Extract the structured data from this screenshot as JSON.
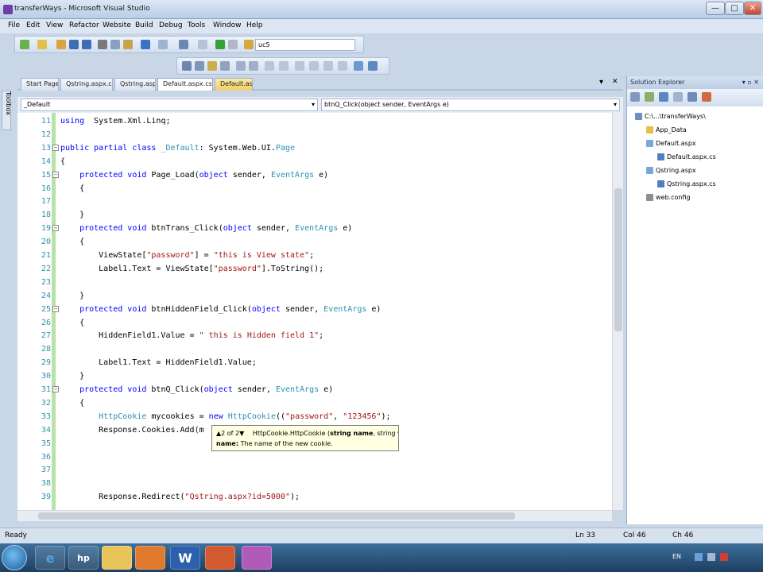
{
  "window": {
    "title": "transferWays - Microsoft Visual Studio",
    "min": "—",
    "max": "□",
    "close": "✕"
  },
  "menu": [
    "File",
    "Edit",
    "View",
    "Refactor",
    "Website",
    "Build",
    "Debug",
    "Tools",
    "Window",
    "Help"
  ],
  "toolbar": {
    "find_combo": "uc5"
  },
  "tabs": [
    "Start Page",
    "Qstring.aspx.cs*",
    "Qstring.aspx",
    "Default.aspx.cs*",
    "Default.aspx"
  ],
  "tab_close": "✕",
  "tab_dropdown": "▾",
  "nav": {
    "class_combo": "_Default",
    "member_combo": "btnQ_Click(object sender, EventArgs e)",
    "arrow": "▾"
  },
  "toolbox_label": "Toolbox",
  "code_lines": [
    {
      "n": "11",
      "fold": "",
      "parts": [
        [
          "kw",
          "using"
        ],
        [
          "",
          "  System.Xml.Linq;"
        ]
      ]
    },
    {
      "n": "12",
      "fold": "",
      "parts": [
        [
          "",
          ""
        ]
      ]
    },
    {
      "n": "13",
      "fold": "−",
      "parts": [
        [
          "kw",
          "public partial class "
        ],
        [
          "ty",
          "_Default"
        ],
        [
          "",
          ": System.Web.UI."
        ],
        [
          "ty",
          "Page"
        ]
      ]
    },
    {
      "n": "14",
      "fold": "",
      "parts": [
        [
          "",
          "{"
        ]
      ]
    },
    {
      "n": "15",
      "fold": "−",
      "parts": [
        [
          "",
          "    "
        ],
        [
          "kw",
          "protected void "
        ],
        [
          "",
          "Page_Load("
        ],
        [
          "kw",
          "object "
        ],
        [
          "",
          "sender, "
        ],
        [
          "ty",
          "EventArgs"
        ],
        [
          "",
          " e)"
        ]
      ]
    },
    {
      "n": "16",
      "fold": "",
      "parts": [
        [
          "",
          "    {"
        ]
      ]
    },
    {
      "n": "17",
      "fold": "",
      "parts": [
        [
          "",
          ""
        ]
      ]
    },
    {
      "n": "18",
      "fold": "",
      "parts": [
        [
          "",
          "    }"
        ]
      ]
    },
    {
      "n": "19",
      "fold": "−",
      "parts": [
        [
          "",
          "    "
        ],
        [
          "kw",
          "protected void "
        ],
        [
          "",
          "btnTrans_Click("
        ],
        [
          "kw",
          "object "
        ],
        [
          "",
          "sender, "
        ],
        [
          "ty",
          "EventArgs"
        ],
        [
          "",
          " e)"
        ]
      ]
    },
    {
      "n": "20",
      "fold": "",
      "parts": [
        [
          "",
          "    {"
        ]
      ]
    },
    {
      "n": "21",
      "fold": "",
      "parts": [
        [
          "",
          "        ViewState["
        ],
        [
          "st",
          "\"password\""
        ],
        [
          "",
          "] = "
        ],
        [
          "st",
          "\"this is View state\""
        ],
        [
          "",
          ";"
        ]
      ]
    },
    {
      "n": "22",
      "fold": "",
      "parts": [
        [
          "",
          "        Label1.Text = ViewState["
        ],
        [
          "st",
          "\"password\""
        ],
        [
          "",
          "].ToString();"
        ]
      ]
    },
    {
      "n": "23",
      "fold": "",
      "parts": [
        [
          "",
          ""
        ]
      ]
    },
    {
      "n": "24",
      "fold": "",
      "parts": [
        [
          "",
          "    }"
        ]
      ]
    },
    {
      "n": "25",
      "fold": "−",
      "parts": [
        [
          "",
          "    "
        ],
        [
          "kw",
          "protected void "
        ],
        [
          "",
          "btnHiddenField_Click("
        ],
        [
          "kw",
          "object "
        ],
        [
          "",
          "sender, "
        ],
        [
          "ty",
          "EventArgs"
        ],
        [
          "",
          " e)"
        ]
      ]
    },
    {
      "n": "26",
      "fold": "",
      "parts": [
        [
          "",
          "    {"
        ]
      ]
    },
    {
      "n": "27",
      "fold": "",
      "parts": [
        [
          "",
          "        HiddenField1.Value = "
        ],
        [
          "st",
          "\" this is Hidden field 1\""
        ],
        [
          "",
          ";"
        ]
      ]
    },
    {
      "n": "28",
      "fold": "",
      "parts": [
        [
          "",
          ""
        ]
      ]
    },
    {
      "n": "29",
      "fold": "",
      "parts": [
        [
          "",
          "        Label1.Text = HiddenField1.Value;"
        ]
      ]
    },
    {
      "n": "30",
      "fold": "",
      "parts": [
        [
          "",
          "    }"
        ]
      ]
    },
    {
      "n": "31",
      "fold": "−",
      "parts": [
        [
          "",
          "    "
        ],
        [
          "kw",
          "protected void "
        ],
        [
          "",
          "btnQ_Click("
        ],
        [
          "kw",
          "object "
        ],
        [
          "",
          "sender, "
        ],
        [
          "ty",
          "EventArgs"
        ],
        [
          "",
          " e)"
        ]
      ]
    },
    {
      "n": "32",
      "fold": "",
      "parts": [
        [
          "",
          "    {"
        ]
      ]
    },
    {
      "n": "33",
      "fold": "",
      "parts": [
        [
          "",
          "        "
        ],
        [
          "ty",
          "HttpCookie"
        ],
        [
          "",
          " mycookies = "
        ],
        [
          "kw",
          "new "
        ],
        [
          "ty",
          "HttpCookie"
        ],
        [
          "",
          "(("
        ],
        [
          "st",
          "\"password\""
        ],
        [
          "",
          ", "
        ],
        [
          "st",
          "\"123456\""
        ],
        [
          "",
          ");"
        ]
      ]
    },
    {
      "n": "34",
      "fold": "",
      "parts": [
        [
          "",
          "        Response.Cookies.Add(m"
        ]
      ]
    },
    {
      "n": "35",
      "fold": "",
      "parts": [
        [
          "",
          ""
        ]
      ]
    },
    {
      "n": "36",
      "fold": "",
      "parts": [
        [
          "",
          ""
        ]
      ]
    },
    {
      "n": "37",
      "fold": "",
      "parts": [
        [
          "",
          ""
        ]
      ]
    },
    {
      "n": "38",
      "fold": "",
      "parts": [
        [
          "",
          ""
        ]
      ]
    },
    {
      "n": "39",
      "fold": "",
      "parts": [
        [
          "",
          "        Response.Redirect("
        ],
        [
          "st",
          "\"Qstring.aspx?id=5000\""
        ],
        [
          "",
          ");"
        ]
      ]
    }
  ],
  "tooltip": {
    "counter": "▲2 of 2▼",
    "signature_pre": "HttpCookie.HttpCookie (",
    "param_bold": "string name",
    "signature_post": ", string value)",
    "param_label": "name:",
    "param_desc": "The name of the new cookie."
  },
  "solution_explorer": {
    "title": "Solution Explorer",
    "pin": "▾ ▫ ✕",
    "tree": [
      {
        "label": "C:\\...\\transferWays\\",
        "indent": 0
      },
      {
        "label": "App_Data",
        "indent": 1
      },
      {
        "label": "Default.aspx",
        "indent": 1
      },
      {
        "label": "Default.aspx.cs",
        "indent": 2
      },
      {
        "label": "Qstring.aspx",
        "indent": 1
      },
      {
        "label": "Qstring.aspx.cs",
        "indent": 2
      },
      {
        "label": "web.config",
        "indent": 1
      }
    ]
  },
  "status": {
    "ready": "Ready",
    "ln": "Ln 33",
    "col": "Col 46",
    "ch": "Ch 46"
  },
  "taskbar": {
    "lang": "EN",
    "apps": [
      "e",
      "hp",
      "",
      "",
      "W",
      "",
      ""
    ]
  },
  "colors": {
    "keyword": "#0000ff",
    "type": "#2b91af",
    "string": "#a31515",
    "line_number": "#2b91af"
  }
}
